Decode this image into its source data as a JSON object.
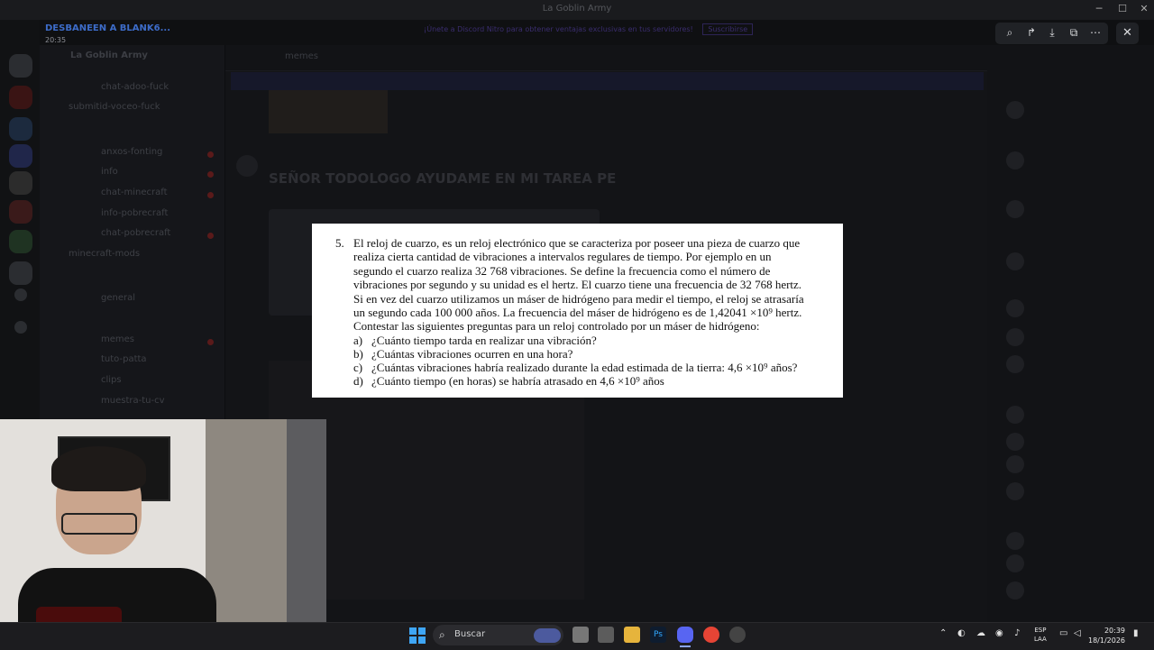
{
  "window": {
    "title": "La Goblin Army"
  },
  "user": {
    "name": "DESBANEEN A BLANK6...",
    "time": "20:35"
  },
  "banner": {
    "text": "¡Únete a Discord Nitro para obtener ventajas exclusivas en tus servidores!",
    "action": "Suscribirse"
  },
  "server": {
    "name": "La Goblin Army"
  },
  "channels": [
    "chat-adoo-fuck",
    "submitid-voceo-fuck",
    "anxos-fonting",
    "info",
    "chat-minecraft",
    "info-pobrecraft",
    "chat-pobrecraft",
    "minecraft-mods",
    "general",
    "memes",
    "tuto-patta",
    "clips",
    "muestra-tu-cv"
  ],
  "chat": {
    "channel": "memes",
    "post_title": "SEÑOR TODOLOGO AYUDAME EN MI TAREA PE"
  },
  "viewer": {
    "close_label": "✕"
  },
  "problem": {
    "number": "5.",
    "lines": [
      "El reloj de cuarzo, es un reloj electrónico que se caracteriza por poseer una pieza de cuarzo que",
      "realiza cierta cantidad de vibraciones a intervalos regulares de tiempo. Por ejemplo en un",
      "segundo el cuarzo realiza 32 768 vibraciones. Se define la frecuencia como el número de",
      "vibraciones por segundo y su unidad es el hertz. El cuarzo tiene una frecuencia de 32 768 hertz.",
      "Si en vez del cuarzo utilizamos un máser de hidrógeno para medir el tiempo, el reloj se atrasaría",
      "un segundo cada 100 000 años. La frecuencia del máser de hidrógeno es de 1,42041 ×10⁹ hertz.",
      "Contestar las siguientes preguntas para un reloj controlado por un máser de hidrógeno:"
    ],
    "options": [
      {
        "letter": "a)",
        "text": "¿Cuánto tiempo tarda en realizar una vibración?"
      },
      {
        "letter": "b)",
        "text": "¿Cuántas vibraciones ocurren en una hora?"
      },
      {
        "letter": "c)",
        "text": "¿Cuántas vibraciones habría realizado durante la edad estimada de la tierra: 4,6 ×10⁹ años?"
      },
      {
        "letter": "d)",
        "text": "¿Cuánto tiempo (en horas) se habría atrasado en 4,6 ×10⁹ años"
      }
    ]
  },
  "taskbar": {
    "search_placeholder": "Buscar",
    "lang_line1": "ESP",
    "lang_line2": "LAA",
    "time": "20:39",
    "date": "18/1/2026"
  }
}
